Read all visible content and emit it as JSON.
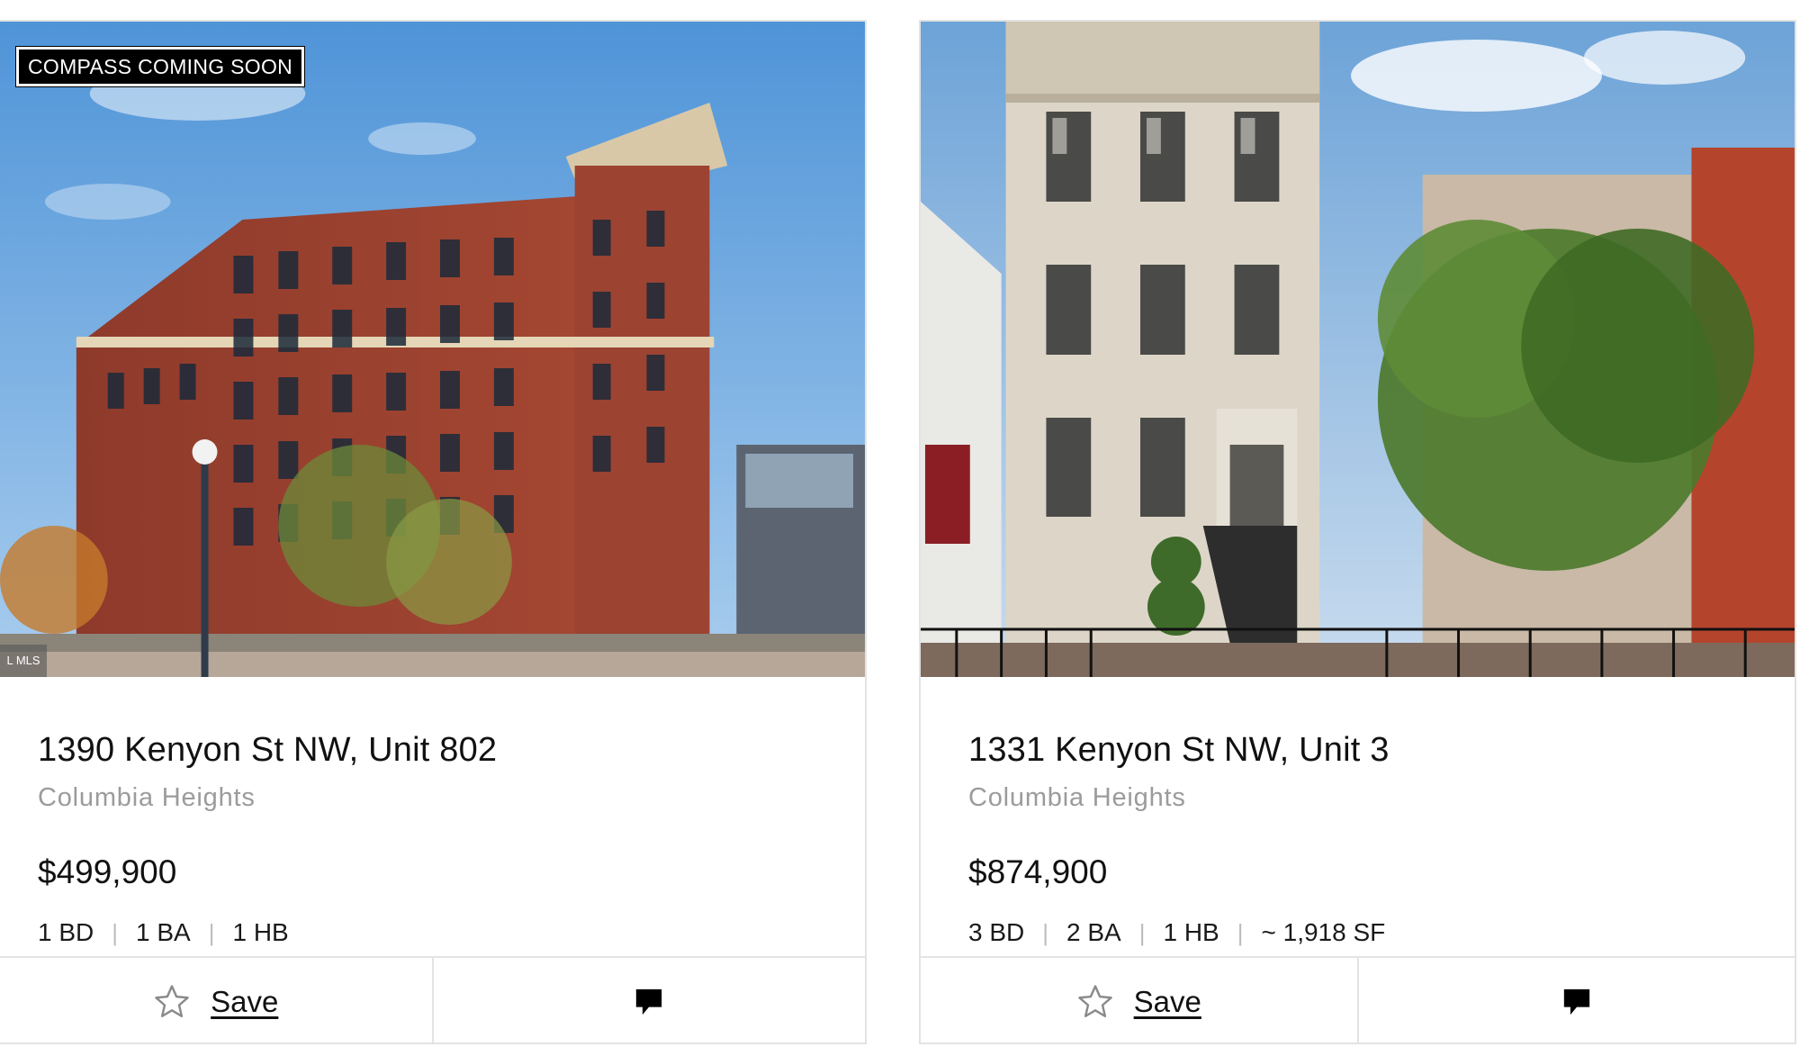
{
  "listings": [
    {
      "badge": "COMPASS COMING SOON",
      "mls_tag": "L MLS",
      "address": "1390 Kenyon St NW, Unit 802",
      "neighborhood": "Columbia Heights",
      "price": "$499,900",
      "specs": [
        "1 BD",
        "1 BA",
        "1 HB"
      ],
      "save_label": "Save",
      "save_icon": "star-outline-icon",
      "message_icon": "chat-bubble-icon"
    },
    {
      "address": "1331 Kenyon St NW, Unit 3",
      "neighborhood": "Columbia Heights",
      "price": "$874,900",
      "specs": [
        "3 BD",
        "2 BA",
        "1 HB",
        "~ 1,918 SF"
      ],
      "save_label": "Save",
      "save_icon": "star-outline-icon",
      "message_icon": "chat-bubble-icon"
    }
  ],
  "colors": {
    "badge_bg": "#000000",
    "muted_text": "#9b9b9b",
    "divider": "#e3e3e3"
  }
}
